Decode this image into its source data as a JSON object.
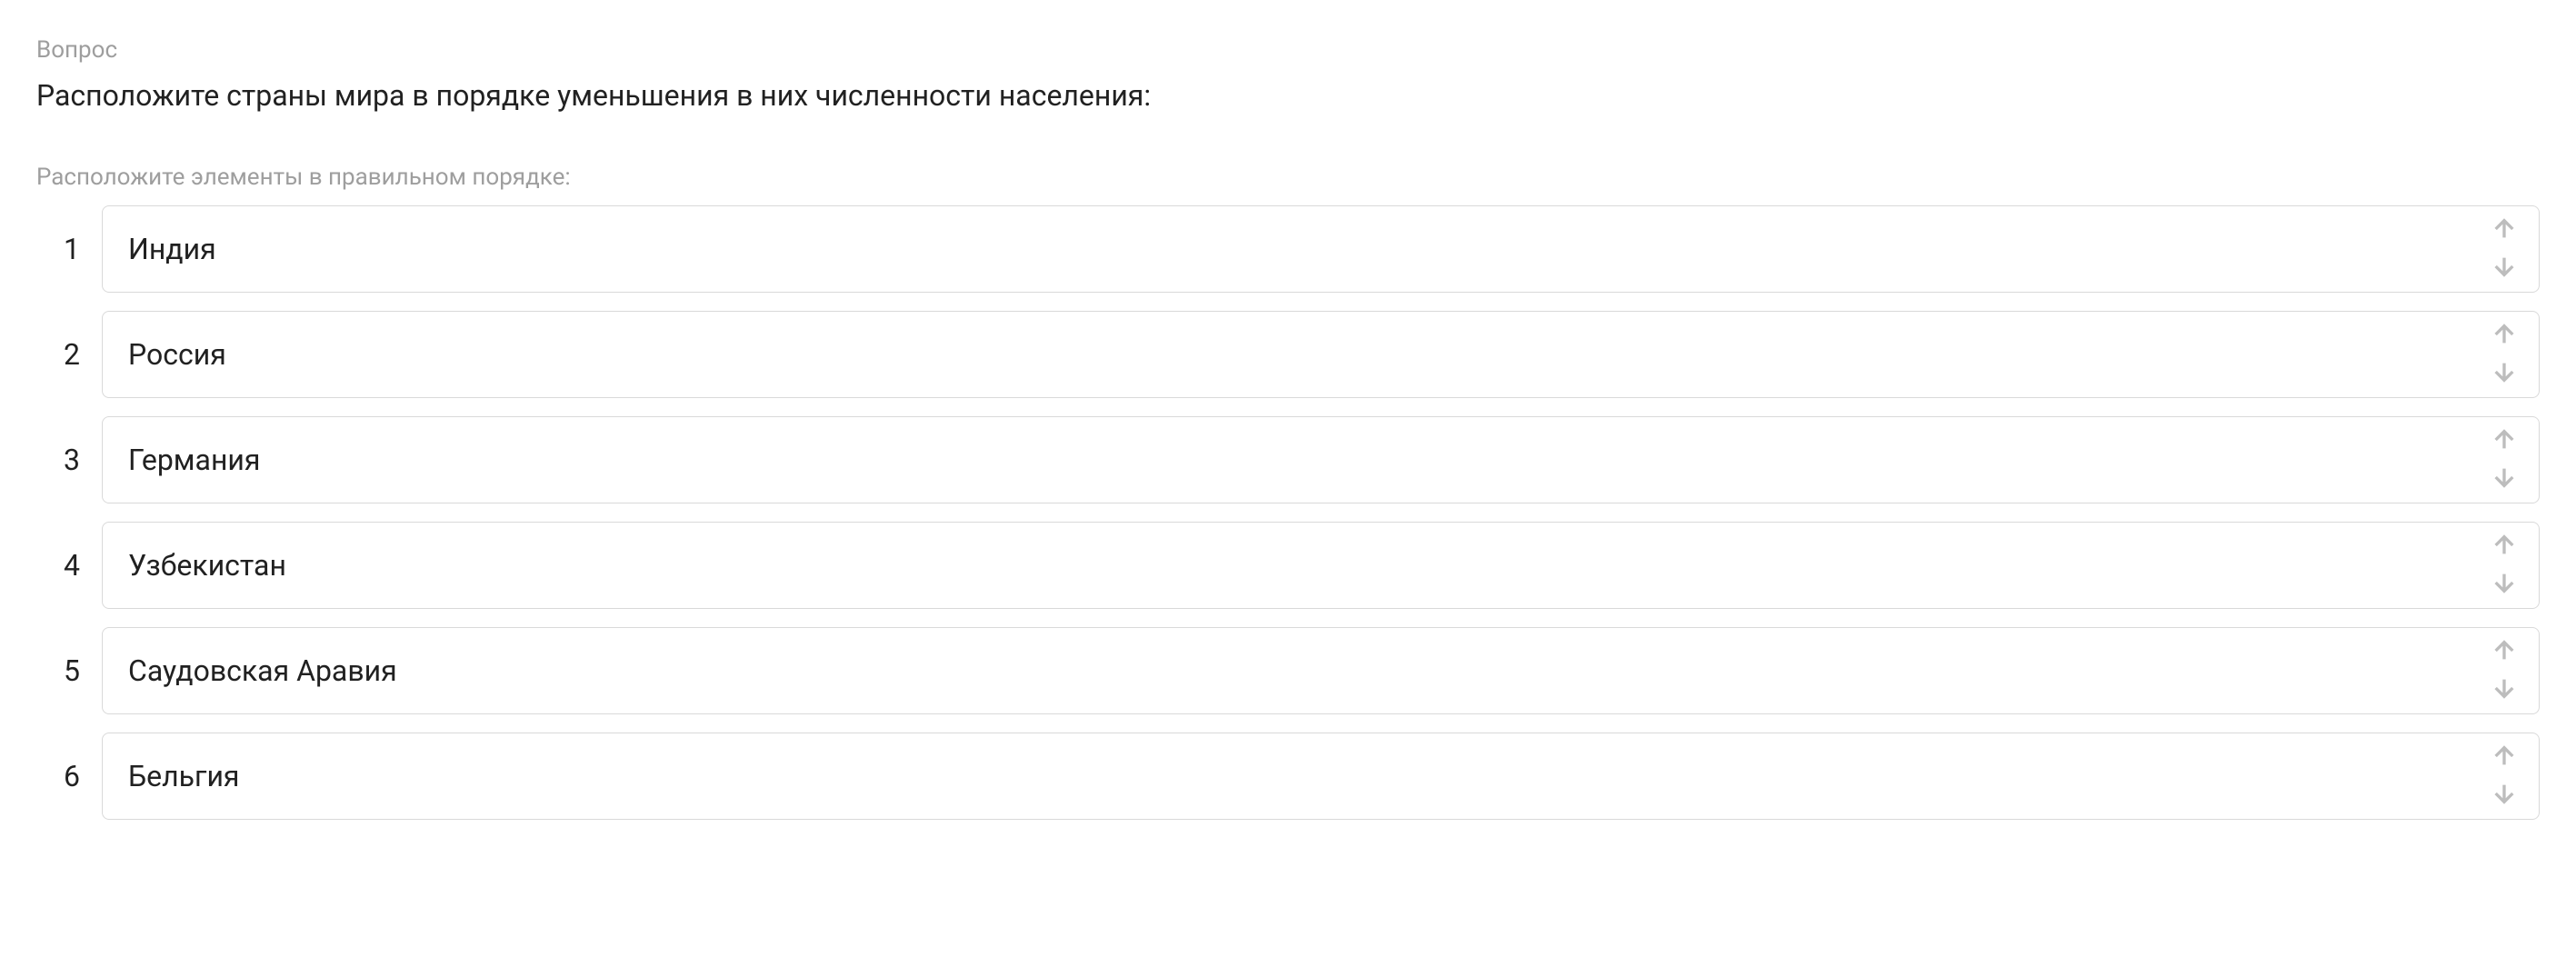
{
  "question_label": "Вопрос",
  "question_text": "Расположите страны мира в порядке уменьшения в них численности населения:",
  "instruction_label": "Расположите элементы в правильном порядке:",
  "items": [
    {
      "number": "1",
      "label": "Индия"
    },
    {
      "number": "2",
      "label": "Россия"
    },
    {
      "number": "3",
      "label": "Германия"
    },
    {
      "number": "4",
      "label": "Узбекистан"
    },
    {
      "number": "5",
      "label": "Саудовская Аравия"
    },
    {
      "number": "6",
      "label": "Бельгия"
    }
  ]
}
